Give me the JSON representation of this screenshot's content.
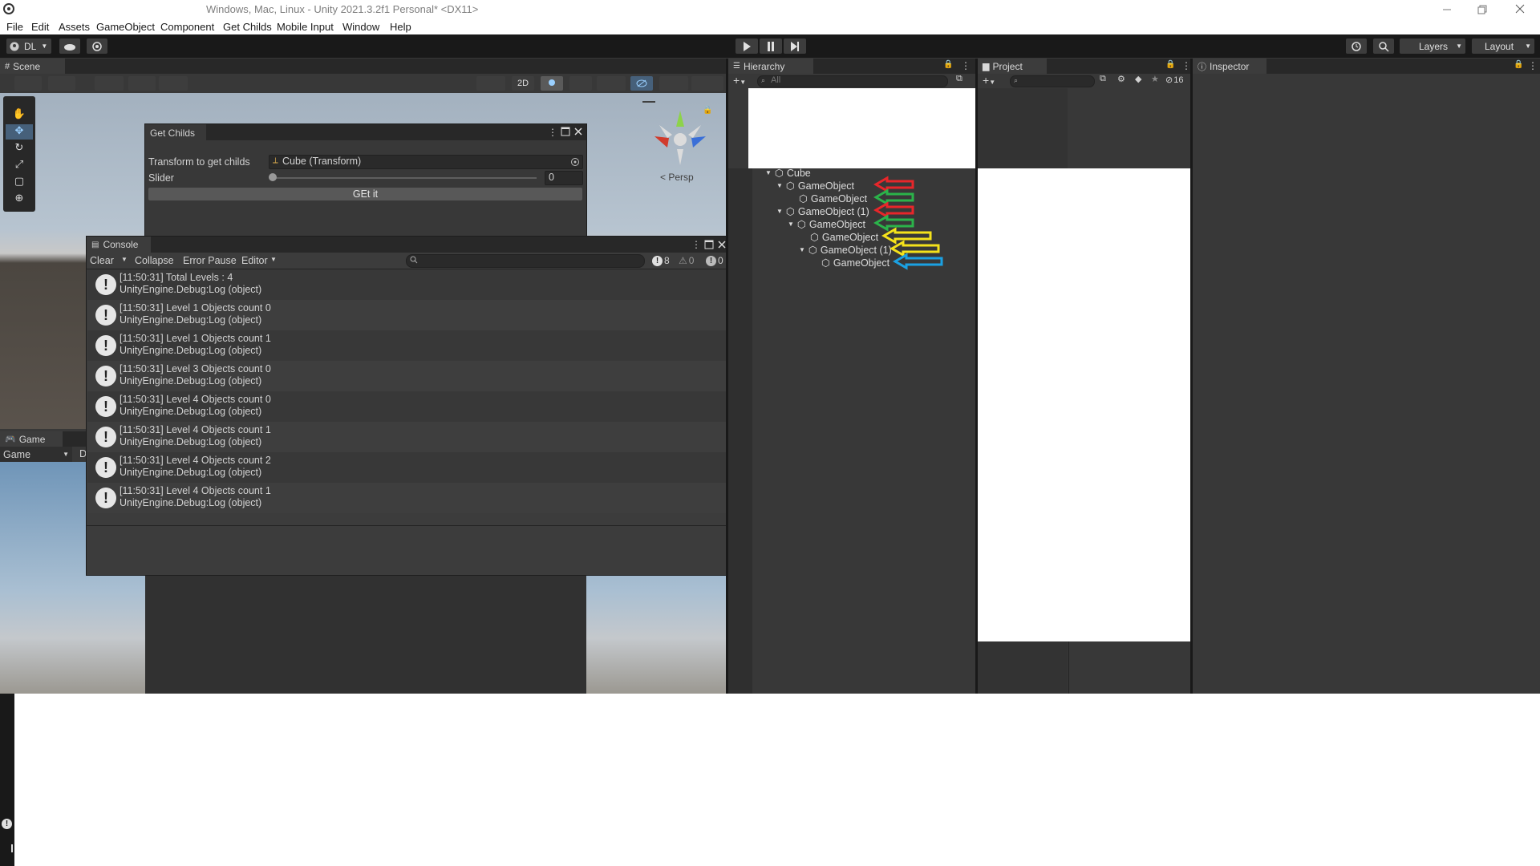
{
  "window": {
    "title": "Windows, Mac, Linux - Unity 2021.3.2f1 Personal* <DX11>"
  },
  "menu": [
    "File",
    "Edit",
    "Assets",
    "GameObject",
    "Component",
    "Get Childs",
    "Mobile Input",
    "Window",
    "Help"
  ],
  "toolbar": {
    "account": "DL",
    "layers": "Layers",
    "layout": "Layout"
  },
  "scene": {
    "tab": "Scene",
    "mode_2d": "2D",
    "persp": "< Persp"
  },
  "get_childs": {
    "title": "Get Childs",
    "transform_label": "Transform to get childs",
    "transform_value": "Cube (Transform)",
    "slider_label": "Slider",
    "slider_value": "0",
    "button": "GEt it"
  },
  "console": {
    "title": "Console",
    "clear": "Clear",
    "collapse": "Collapse",
    "error_pause": "Error Pause",
    "editor": "Editor",
    "count_logs": "8",
    "count_warnings": "0",
    "count_errors": "0",
    "entries": [
      {
        "msg": "[11:50:31] Total Levels : 4",
        "src": "UnityEngine.Debug:Log (object)"
      },
      {
        "msg": "[11:50:31] Level 1 Objects count 0",
        "src": "UnityEngine.Debug:Log (object)"
      },
      {
        "msg": "[11:50:31] Level 1 Objects count 1",
        "src": "UnityEngine.Debug:Log (object)"
      },
      {
        "msg": "[11:50:31] Level 3 Objects count 0",
        "src": "UnityEngine.Debug:Log (object)"
      },
      {
        "msg": "[11:50:31] Level 4 Objects count 0",
        "src": "UnityEngine.Debug:Log (object)"
      },
      {
        "msg": "[11:50:31] Level 4 Objects count 1",
        "src": "UnityEngine.Debug:Log (object)"
      },
      {
        "msg": "[11:50:31] Level 4 Objects count 2",
        "src": "UnityEngine.Debug:Log (object)"
      },
      {
        "msg": "[11:50:31] Level 4 Objects count 1",
        "src": "UnityEngine.Debug:Log (object)"
      }
    ]
  },
  "game": {
    "tab": "Game",
    "display": "Game",
    "display2": "D"
  },
  "hierarchy": {
    "tab": "Hierarchy",
    "search_placeholder": "All",
    "items": [
      {
        "label": "Cube",
        "arrow": ""
      },
      {
        "label": "GameObject",
        "arrow": "#e8262a"
      },
      {
        "label": "GameObject",
        "arrow": "#2bb34a"
      },
      {
        "label": "GameObject (1)",
        "arrow": "#e8262a"
      },
      {
        "label": "GameObject",
        "arrow": "#2bb34a"
      },
      {
        "label": "GameObject",
        "arrow": "#f5e21b"
      },
      {
        "label": "GameObject (1)",
        "arrow": "#f5e21b"
      },
      {
        "label": "GameObject",
        "arrow": "#1ba1e2"
      }
    ]
  },
  "project": {
    "tab": "Project",
    "hidden_count": "16"
  },
  "inspector": {
    "tab": "Inspector"
  }
}
